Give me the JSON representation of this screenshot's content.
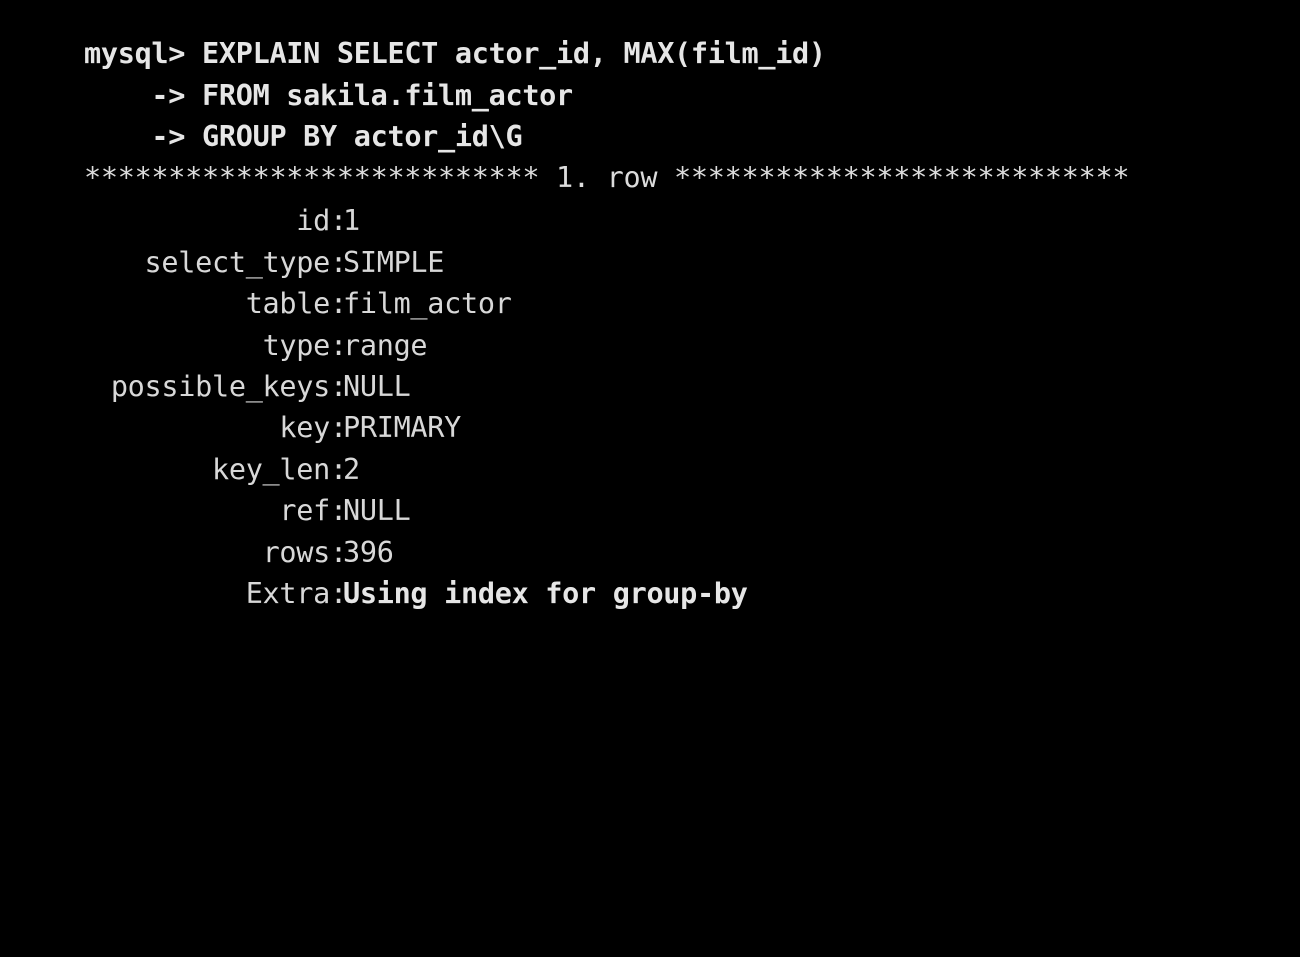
{
  "terminal": {
    "prompt": "mysql> ",
    "continuation": "    -> ",
    "command_lines": [
      "EXPLAIN SELECT actor_id, MAX(film_id)",
      "FROM sakila.film_actor",
      "GROUP BY actor_id\\G"
    ],
    "row_separator": "*************************** 1. row ***************************",
    "fields": [
      {
        "label": "id",
        "value": "1"
      },
      {
        "label": "select_type",
        "value": "SIMPLE"
      },
      {
        "label": "table",
        "value": "film_actor"
      },
      {
        "label": "type",
        "value": "range"
      },
      {
        "label": "possible_keys",
        "value": "NULL"
      },
      {
        "label": "key",
        "value": "PRIMARY"
      },
      {
        "label": "key_len",
        "value": "2"
      },
      {
        "label": "ref",
        "value": "NULL"
      },
      {
        "label": "rows",
        "value": "396"
      },
      {
        "label": "Extra",
        "value": "Using index for group-by"
      }
    ],
    "colors": {
      "background": "#000000",
      "text": "#d8d8d8"
    }
  }
}
